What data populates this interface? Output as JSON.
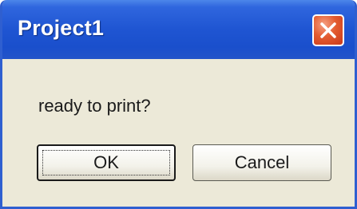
{
  "window": {
    "title": "Project1",
    "close_icon": "close-icon",
    "titlebar_color": "#1f55d2",
    "close_color": "#e35b2f"
  },
  "dialog": {
    "message": "ready to print?",
    "buttons": {
      "ok_label": "OK",
      "cancel_label": "Cancel"
    }
  }
}
